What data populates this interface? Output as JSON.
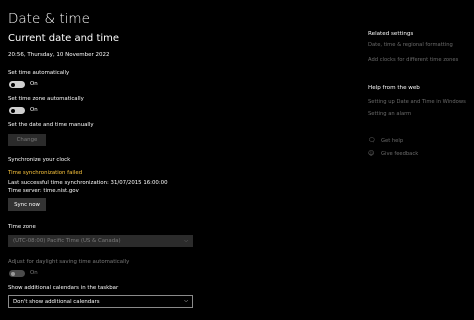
{
  "header": {
    "title": "Date & time"
  },
  "current": {
    "heading": "Current date and time",
    "datetime": "20:56, Thursday, 10 November 2022"
  },
  "set_time_auto": {
    "label": "Set time automatically",
    "state": "On"
  },
  "set_timezone_auto": {
    "label": "Set time zone automatically",
    "state": "On"
  },
  "manual": {
    "label": "Set the date and time manually",
    "button": "Change"
  },
  "sync": {
    "heading": "Synchronize your clock",
    "status": "Time synchronization failed",
    "last_sync": "Last successful time synchronization: 31/07/2015 16:00:00",
    "server": "Time server: time.nist.gov",
    "button": "Sync now"
  },
  "timezone": {
    "label": "Time zone",
    "value": "(UTC-08:00) Pacific Time (US & Canada)"
  },
  "dst": {
    "label": "Adjust for daylight saving time automatically",
    "state": "On"
  },
  "calendars": {
    "label": "Show additional calendars in the taskbar",
    "value": "Don't show additional calendars"
  },
  "sidebar": {
    "related_heading": "Related settings",
    "related_links": [
      "Date, time & regional formatting",
      "Add clocks for different time zones"
    ],
    "web_heading": "Help from the web",
    "web_links": [
      "Setting up Date and Time in Windows",
      "Setting an alarm"
    ],
    "get_help": "Get help",
    "give_feedback": "Give feedback"
  },
  "colors": {
    "background": "#000000",
    "warning": "#ffc83d",
    "toggle_on": "#cfcfcf",
    "link_dim": "#6b6b6b"
  },
  "icons": {
    "chevron": "chevron-down-icon",
    "help": "help-chat-icon",
    "feedback": "feedback-icon"
  }
}
